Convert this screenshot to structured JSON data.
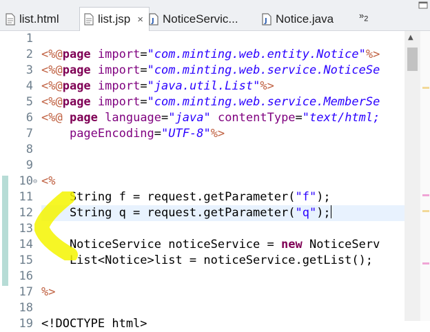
{
  "tabs": [
    {
      "label": "list.html",
      "icon": "html-file-icon",
      "active": false
    },
    {
      "label": "list.jsp",
      "icon": "jsp-file-icon",
      "active": true,
      "close": "×"
    },
    {
      "label": "NoticeServic...",
      "icon": "java-file-icon",
      "active": false
    },
    {
      "label": "Notice.java",
      "icon": "java-file-icon",
      "active": false
    }
  ],
  "overflow": {
    "chevron": "»",
    "count": "2"
  },
  "editor": {
    "current_line": 12,
    "lines": [
      {
        "n": "1",
        "tokens": []
      },
      {
        "n": "2",
        "tokens": [
          {
            "t": "<%@",
            "c": "dir"
          },
          {
            "t": "page ",
            "c": "kw"
          },
          {
            "t": "import",
            "c": "attr"
          },
          {
            "t": "=",
            "c": "text"
          },
          {
            "t": "\"com.minting.web.entity.Notice\"",
            "c": "str"
          },
          {
            "t": "%>",
            "c": "dir"
          }
        ]
      },
      {
        "n": "3",
        "tokens": [
          {
            "t": "<%@",
            "c": "dir"
          },
          {
            "t": "page ",
            "c": "kw"
          },
          {
            "t": "import",
            "c": "attr"
          },
          {
            "t": "=",
            "c": "text"
          },
          {
            "t": "\"com.minting.web.service.NoticeSe",
            "c": "str"
          }
        ]
      },
      {
        "n": "4",
        "tokens": [
          {
            "t": "<%@",
            "c": "dir"
          },
          {
            "t": "page ",
            "c": "kw"
          },
          {
            "t": "import",
            "c": "attr"
          },
          {
            "t": "=",
            "c": "text"
          },
          {
            "t": "\"java.util.List\"",
            "c": "str"
          },
          {
            "t": "%>",
            "c": "dir"
          }
        ]
      },
      {
        "n": "5",
        "tokens": [
          {
            "t": "<%@",
            "c": "dir"
          },
          {
            "t": "page ",
            "c": "kw"
          },
          {
            "t": "import",
            "c": "attr"
          },
          {
            "t": "=",
            "c": "text"
          },
          {
            "t": "\"com.minting.web.service.MemberSe",
            "c": "str"
          }
        ]
      },
      {
        "n": "6",
        "tokens": [
          {
            "t": "<%@ ",
            "c": "dir"
          },
          {
            "t": "page ",
            "c": "kw"
          },
          {
            "t": "language",
            "c": "attr"
          },
          {
            "t": "=",
            "c": "text"
          },
          {
            "t": "\"java\"",
            "c": "str"
          },
          {
            "t": " ",
            "c": "text"
          },
          {
            "t": "contentType",
            "c": "attr"
          },
          {
            "t": "=",
            "c": "text"
          },
          {
            "t": "\"text/html;",
            "c": "str"
          }
        ]
      },
      {
        "n": "7",
        "tokens": [
          {
            "t": "    ",
            "c": "text"
          },
          {
            "t": "pageEncoding",
            "c": "attr"
          },
          {
            "t": "=",
            "c": "text"
          },
          {
            "t": "\"UTF-8\"",
            "c": "str"
          },
          {
            "t": "%>",
            "c": "dir"
          }
        ]
      },
      {
        "n": "8",
        "tokens": []
      },
      {
        "n": "9",
        "tokens": []
      },
      {
        "n": "10",
        "fold": "⊖",
        "tokens": [
          {
            "t": "<%",
            "c": "dir"
          }
        ]
      },
      {
        "n": "11",
        "tokens": [
          {
            "t": "    String f = request.getParameter(",
            "c": "text"
          },
          {
            "t": "\"f\"",
            "c": "jstr"
          },
          {
            "t": ");",
            "c": "text"
          }
        ]
      },
      {
        "n": "12",
        "tokens": [
          {
            "t": "    String q = request.getParameter(",
            "c": "text"
          },
          {
            "t": "\"q\"",
            "c": "jstr"
          },
          {
            "t": ");",
            "c": "text"
          }
        ]
      },
      {
        "n": "13",
        "tokens": []
      },
      {
        "n": "14",
        "tokens": [
          {
            "t": "    NoticeService noticeService = ",
            "c": "text"
          },
          {
            "t": "new",
            "c": "kw"
          },
          {
            "t": " NoticeServ",
            "c": "text"
          }
        ]
      },
      {
        "n": "15",
        "tokens": [
          {
            "t": "    List<Notice>list = noticeService.getList();",
            "c": "text"
          }
        ]
      },
      {
        "n": "16",
        "tokens": []
      },
      {
        "n": "17",
        "tokens": [
          {
            "t": "%>",
            "c": "dir"
          }
        ]
      },
      {
        "n": "18",
        "tokens": []
      },
      {
        "n": "19",
        "tokens": [
          {
            "t": "<!DOCTYPE html>",
            "c": "text"
          }
        ]
      }
    ]
  },
  "colors": {
    "directive": "#bf5f3f",
    "keyword": "#7f0055",
    "attribute": "#7f007f",
    "string": "#2a00ff",
    "current_line": "#e8f2fe",
    "highlighter": "#f5f500"
  }
}
